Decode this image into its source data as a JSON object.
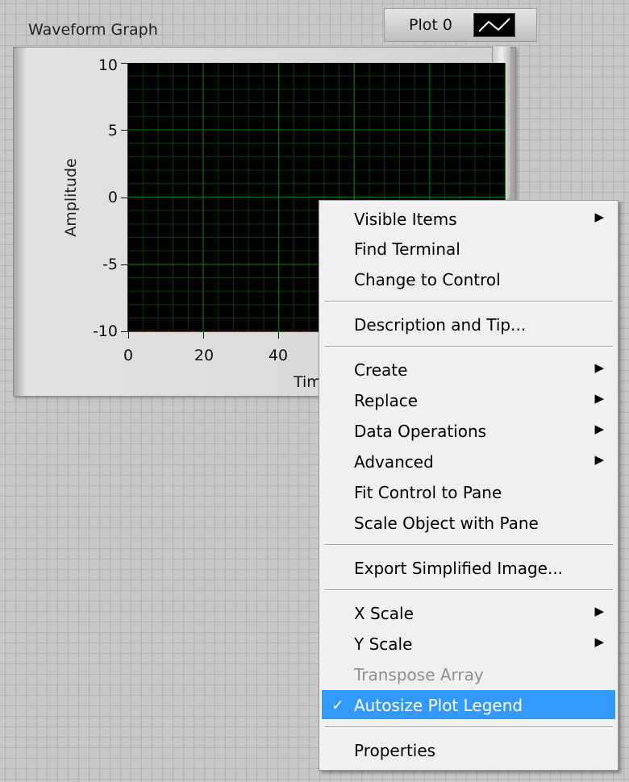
{
  "graph": {
    "label": "Waveform Graph",
    "legend_plot_name": "Plot 0",
    "y_axis_title": "Amplitude",
    "x_axis_title_visible": "Tim",
    "y_ticks": [
      "10",
      "5",
      "0",
      "-5",
      "-10"
    ],
    "x_ticks": [
      "0",
      "20",
      "40"
    ],
    "colors": {
      "plot_bg": "#000000",
      "grid_major": "#0a7a0a",
      "grid_minor": "#0a3a0a"
    }
  },
  "context_menu": {
    "items": [
      {
        "label": "Visible Items",
        "submenu": true
      },
      {
        "label": "Find Terminal"
      },
      {
        "label": "Change to Control"
      },
      {
        "label": "Description and Tip..."
      },
      {
        "label": "Create",
        "submenu": true
      },
      {
        "label": "Replace",
        "submenu": true
      },
      {
        "label": "Data Operations",
        "submenu": true
      },
      {
        "label": "Advanced",
        "submenu": true
      },
      {
        "label": "Fit Control to Pane"
      },
      {
        "label": "Scale Object with Pane"
      },
      {
        "label": "Export Simplified Image..."
      },
      {
        "label": "X Scale",
        "submenu": true
      },
      {
        "label": "Y Scale",
        "submenu": true
      },
      {
        "label": "Transpose Array",
        "disabled": true
      },
      {
        "label": "Autosize Plot Legend",
        "checked": true,
        "highlighted": true
      },
      {
        "label": "Properties"
      }
    ],
    "highlight_color": "#3399ff",
    "arrow_glyph": "▶",
    "check_glyph": "✓"
  }
}
